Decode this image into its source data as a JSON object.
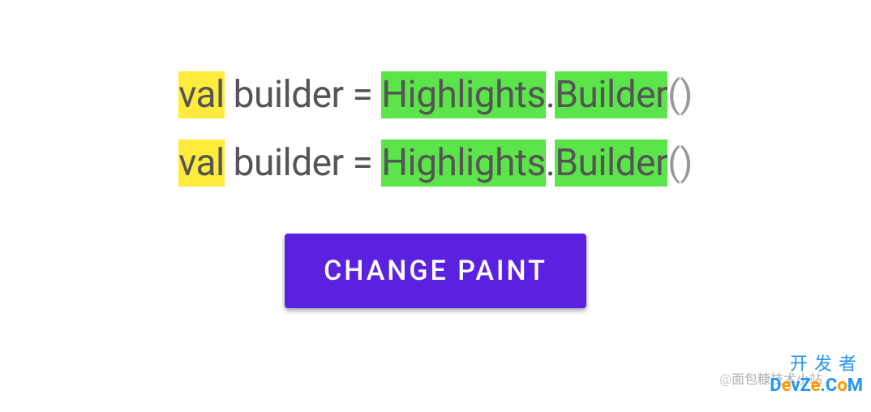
{
  "lines": [
    {
      "tokens": [
        {
          "text": "val",
          "highlight": "yellow"
        },
        {
          "text": " builder = ",
          "highlight": "none"
        },
        {
          "text": "Highlights",
          "highlight": "green"
        },
        {
          "text": ".",
          "highlight": "none"
        },
        {
          "text": "Builder",
          "highlight": "green"
        },
        {
          "text": "()",
          "highlight": "paren"
        }
      ]
    },
    {
      "tokens": [
        {
          "text": "val",
          "highlight": "yellow"
        },
        {
          "text": " builder = ",
          "highlight": "none"
        },
        {
          "text": "Highlights",
          "highlight": "green"
        },
        {
          "text": ".",
          "highlight": "none"
        },
        {
          "text": "Builder",
          "highlight": "green"
        },
        {
          "text": "()",
          "highlight": "paren"
        }
      ]
    }
  ],
  "button": {
    "label": "CHANGE PAINT"
  },
  "watermark1": "@面包糠技术小站",
  "watermark2": {
    "cn": "开发者",
    "en_parts": [
      "D",
      "e",
      "v",
      "Z",
      "e",
      ".",
      "C",
      "o",
      "M"
    ]
  },
  "colors": {
    "yellow_highlight": "#FFEB3B",
    "green_highlight": "#5BE54B",
    "button_bg": "#5B21E0",
    "button_text": "#FFFFFF",
    "text": "#555555",
    "paren": "#999999"
  }
}
